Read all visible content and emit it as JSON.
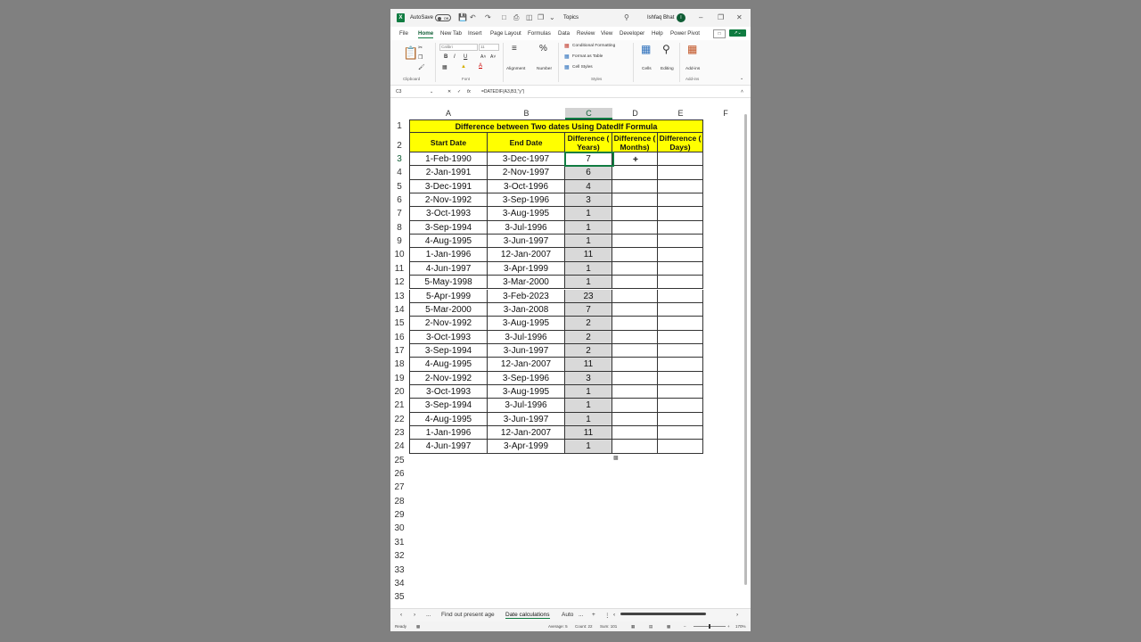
{
  "titlebar": {
    "autosave_label": "AutoSave",
    "autosave_state": "Off",
    "search_text": "Topics",
    "user_name": "Ishfaq Bhat",
    "avatar_letter": "I"
  },
  "menu": [
    "File",
    "Home",
    "New Tab",
    "Insert",
    "Page Layout",
    "Formulas",
    "Data",
    "Review",
    "View",
    "Developer",
    "Help",
    "Power Pivot"
  ],
  "ribbon": {
    "font_name": "Calibri",
    "font_size": "11",
    "bold": "B",
    "italic": "I",
    "underline": "U",
    "alignment": "Alignment",
    "number": "Number",
    "cond_format": "Conditional Formatting",
    "format_table": "Format as Table",
    "cell_styles": "Cell Styles",
    "cells": "Cells",
    "editing": "Editing",
    "addins": "Add-ins",
    "grp_clipboard": "Clipboard",
    "grp_font": "Font",
    "grp_styles": "Styles",
    "grp_addins": "Add-ins"
  },
  "formula_bar": {
    "name_box": "C3",
    "fx": "fx",
    "formula": "=DATEDIF(A3,B3,\"y\")"
  },
  "sheet": {
    "columns": [
      "A",
      "B",
      "C",
      "D",
      "E",
      "F"
    ],
    "title": "Difference between Two dates Using DatedIf Formula",
    "headers": {
      "start": "Start Date",
      "end": "End Date",
      "years": "Difference ( Years)",
      "months": "Difference ( Months)",
      "days": "Difference ( Days)"
    },
    "rows": [
      {
        "start": "1-Feb-1990",
        "end": "3-Dec-1997",
        "years": "7"
      },
      {
        "start": "2-Jan-1991",
        "end": "2-Nov-1997",
        "years": "6"
      },
      {
        "start": "3-Dec-1991",
        "end": "3-Oct-1996",
        "years": "4"
      },
      {
        "start": "2-Nov-1992",
        "end": "3-Sep-1996",
        "years": "3"
      },
      {
        "start": "3-Oct-1993",
        "end": "3-Aug-1995",
        "years": "1"
      },
      {
        "start": "3-Sep-1994",
        "end": "3-Jul-1996",
        "years": "1"
      },
      {
        "start": "4-Aug-1995",
        "end": "3-Jun-1997",
        "years": "1"
      },
      {
        "start": "1-Jan-1996",
        "end": "12-Jan-2007",
        "years": "11"
      },
      {
        "start": "4-Jun-1997",
        "end": "3-Apr-1999",
        "years": "1"
      },
      {
        "start": "5-May-1998",
        "end": "3-Mar-2000",
        "years": "1"
      },
      {
        "start": "5-Apr-1999",
        "end": "3-Feb-2023",
        "years": "23"
      },
      {
        "start": "5-Mar-2000",
        "end": "3-Jan-2008",
        "years": "7"
      },
      {
        "start": "2-Nov-1992",
        "end": "3-Aug-1995",
        "years": "2"
      },
      {
        "start": "3-Oct-1993",
        "end": "3-Jul-1996",
        "years": "2"
      },
      {
        "start": "3-Sep-1994",
        "end": "3-Jun-1997",
        "years": "2"
      },
      {
        "start": "4-Aug-1995",
        "end": "12-Jan-2007",
        "years": "11"
      },
      {
        "start": "2-Nov-1992",
        "end": "3-Sep-1996",
        "years": "3"
      },
      {
        "start": "3-Oct-1993",
        "end": "3-Aug-1995",
        "years": "1"
      },
      {
        "start": "3-Sep-1994",
        "end": "3-Jul-1996",
        "years": "1"
      },
      {
        "start": "4-Aug-1995",
        "end": "3-Jun-1997",
        "years": "1"
      },
      {
        "start": "1-Jan-1996",
        "end": "12-Jan-2007",
        "years": "11"
      },
      {
        "start": "4-Jun-1997",
        "end": "3-Apr-1999",
        "years": "1"
      }
    ],
    "row_numbers": [
      "1",
      "2",
      "3",
      "4",
      "5",
      "6",
      "7",
      "8",
      "9",
      "10",
      "11",
      "12",
      "13",
      "14",
      "15",
      "16",
      "17",
      "18",
      "19",
      "20",
      "21",
      "22",
      "23",
      "24",
      "25",
      "26",
      "27",
      "28",
      "29",
      "30",
      "31",
      "32",
      "33",
      "34",
      "35"
    ]
  },
  "tabs": {
    "tab1": "Find out present age",
    "tab2": "Date calculations",
    "tab3": "Auto",
    "more": "...",
    "add": "+"
  },
  "status": {
    "ready": "Ready",
    "average": "Average: 5",
    "count": "Count: 22",
    "sum": "Sum: 101",
    "zoom": "170%"
  },
  "colors": {
    "excel_green": "#107c41",
    "header_yellow": "#ffff00",
    "selection_gray": "#d9d9d9"
  }
}
